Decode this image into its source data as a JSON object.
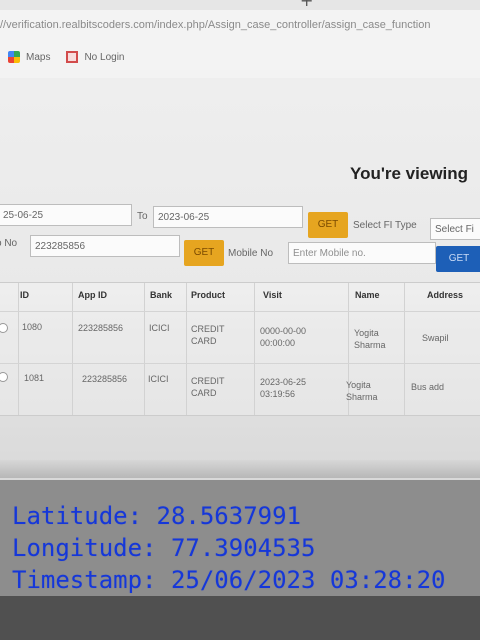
{
  "browser": {
    "url": "//verification.realbitscoders.com/index.php/Assign_case_controller/assign_case_function",
    "bookmarks": [
      {
        "label": "Maps",
        "icon": "maps-icon"
      },
      {
        "label": "No Login",
        "icon": "no-login-icon"
      }
    ]
  },
  "page": {
    "viewing_text": "You're viewing",
    "filters": {
      "from_date": "25-06-25",
      "to_label": "To",
      "to_date": "2023-06-25",
      "get_label": "GET",
      "select_type_label": "Select FI Type",
      "select_type_value": "Select Fi",
      "app_no_label": "o No",
      "app_no_value": "223285856",
      "mobile_label": "Mobile No",
      "mobile_placeholder": "Enter Mobile no.",
      "get_blue_label": "GET"
    },
    "table": {
      "headers": [
        "ID",
        "App ID",
        "Bank",
        "Product",
        "Visit",
        "Name",
        "Address"
      ],
      "rows": [
        {
          "id": "1080",
          "app_id": "223285856",
          "bank": "ICICI",
          "product": "CREDIT\nCARD",
          "visit": "0000-00-00\n00:00:00",
          "name": "Yogita\nSharma",
          "address": "Swapil"
        },
        {
          "id": "1081",
          "app_id": "223285856",
          "bank": "ICICI",
          "product": "CREDIT\nCARD",
          "visit": "2023-06-25\n03:19:56",
          "name": "Yogita\nSharma",
          "address": "Bus add"
        }
      ]
    }
  },
  "overlay": {
    "latitude": "Latitude: 28.5637991",
    "longitude": "Longitude: 77.3904535",
    "timestamp": "Timestamp: 25/06/2023 03:28:20"
  },
  "colors": {
    "accent_yellow": "#e6a520",
    "accent_blue": "#1d5fb7",
    "overlay_blue": "#1537d9"
  }
}
